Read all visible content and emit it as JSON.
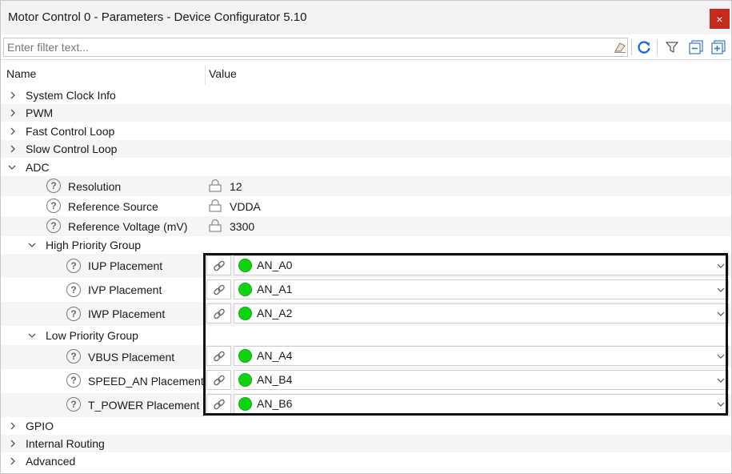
{
  "window": {
    "title": "Motor Control 0 - Parameters - Device Configurator 5.10",
    "close_label": "×"
  },
  "filter": {
    "placeholder": "Enter filter text..."
  },
  "toolbar": {
    "icons": [
      "eraser-icon",
      "refresh-icon",
      "filter-icon",
      "collapse-all-icon",
      "expand-all-icon"
    ]
  },
  "columns": {
    "name": "Name",
    "value": "Value"
  },
  "tree": {
    "system_clock": "System Clock Info",
    "pwm": "PWM",
    "fast_loop": "Fast Control Loop",
    "slow_loop": "Slow Control Loop",
    "adc": {
      "label": "ADC",
      "resolution": {
        "label": "Resolution",
        "value": "12"
      },
      "ref_source": {
        "label": "Reference Source",
        "value": "VDDA"
      },
      "ref_voltage": {
        "label": "Reference Voltage (mV)",
        "value": "3300"
      },
      "high_group": {
        "label": "High Priority Group",
        "iup": {
          "label": "IUP Placement",
          "value": "AN_A0"
        },
        "ivp": {
          "label": "IVP Placement",
          "value": "AN_A1"
        },
        "iwp": {
          "label": "IWP Placement",
          "value": "AN_A2"
        }
      },
      "low_group": {
        "label": "Low Priority Group",
        "vbus": {
          "label": "VBUS Placement",
          "value": "AN_A4"
        },
        "speed": {
          "label": "SPEED_AN Placement",
          "value": "AN_B4"
        },
        "tpower": {
          "label": "T_POWER Placement",
          "value": "AN_B6"
        }
      }
    },
    "gpio": "GPIO",
    "routing": "Internal Routing",
    "advanced": "Advanced"
  },
  "colors": {
    "status_ok": "#12d312",
    "close": "#c42b1c",
    "alt_row": "#f5f5f5"
  }
}
